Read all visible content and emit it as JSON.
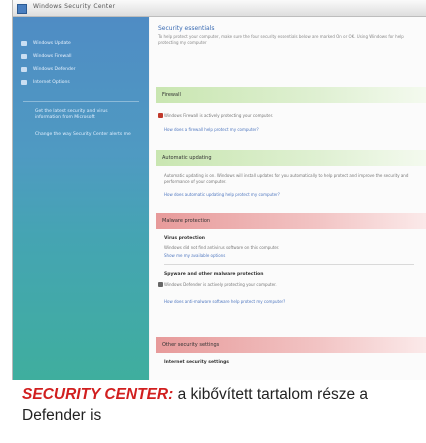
{
  "window": {
    "title": "Windows Security Center"
  },
  "sidebar": {
    "items": [
      {
        "label": "Windows Update",
        "icon": "windows-update-icon"
      },
      {
        "label": "Windows Firewall",
        "icon": "firewall-icon"
      },
      {
        "label": "Windows Defender",
        "icon": "defender-icon"
      },
      {
        "label": "Internet Options",
        "icon": "internet-options-icon"
      }
    ],
    "links": [
      "Get the latest security and virus information from Microsoft",
      "Change the way Security Center alerts me"
    ]
  },
  "main": {
    "title": "Security essentials",
    "subtitle": "To help protect your computer, make sure the four security essentials below are marked On or OK. Using Windows for help protecting my computer",
    "sections": [
      {
        "name": "Firewall",
        "color": "green"
      },
      {
        "name": "Automatic updating",
        "color": "green"
      },
      {
        "name": "Malware protection",
        "color": "red"
      },
      {
        "name": "Other security settings",
        "color": "red"
      }
    ],
    "firewall_status": "Windows Firewall is actively protecting your computer.",
    "firewall_link": "How does a firewall help protect my computer?",
    "updates_status": "Automatic updating is on. Windows will install updates for you automatically to help protect and improve the security and performance of your computer.",
    "updates_link": "How does automatic updating help protect my computer?",
    "virus_heading": "Virus protection",
    "virus_text": "Windows did not find antivirus software on this computer.",
    "virus_link": "Show me my available options",
    "spyware_heading": "Spyware and other malware protection",
    "spyware_text": "Windows Defender is actively protecting your computer.",
    "malware_link": "How does anti-malware software help protect my computer?",
    "internet_heading": "Internet security settings"
  },
  "caption": {
    "highlight": "SECURITY CENTER:",
    "text": " a kibővített tartalom része a Defender is"
  },
  "colors": {
    "sidebar_top": "#4f8cc4",
    "sidebar_bottom": "#3fae9e",
    "section_green": "#c9e6b1",
    "section_red": "#e79a9a",
    "caption_highlight": "#d11f1f"
  }
}
